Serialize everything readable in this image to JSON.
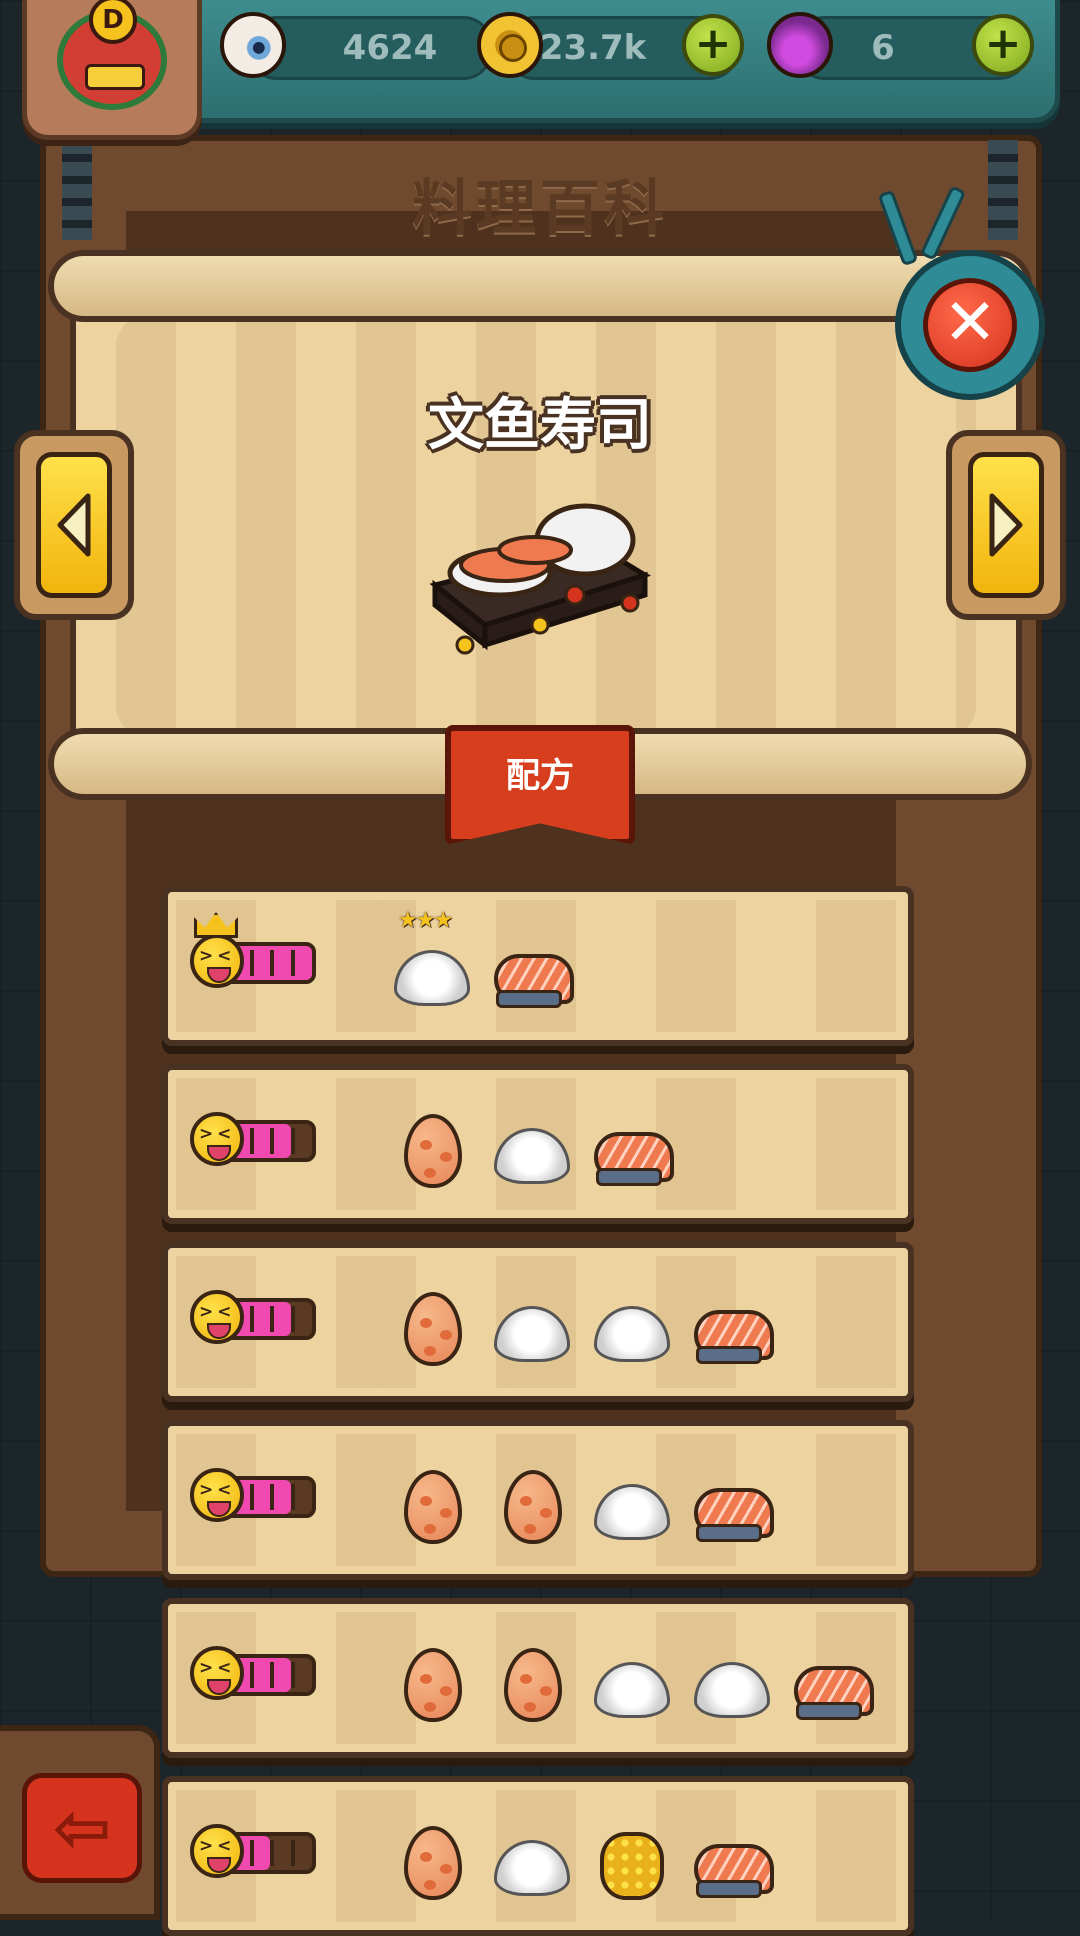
{
  "hud": {
    "rank_letter": "D",
    "eyes": "4624",
    "coins": "23.7k",
    "potions": "6",
    "plus_symbol": "+"
  },
  "board": {
    "title": "料理百科"
  },
  "dish": {
    "name": "文鱼寿司",
    "image_icon": "salmon-sushi-dish"
  },
  "recipe_label": "配方",
  "close_symbol": "✕",
  "back_symbol": "⇦",
  "recipes": [
    {
      "happiness_segments": 5,
      "crown": true,
      "stars": 3,
      "ingredients": [
        "rice",
        "salmon"
      ]
    },
    {
      "happiness_segments": 4,
      "crown": false,
      "stars": 0,
      "ingredients": [
        "egg",
        "rice",
        "salmon"
      ]
    },
    {
      "happiness_segments": 4,
      "crown": false,
      "stars": 0,
      "ingredients": [
        "egg",
        "rice",
        "rice",
        "salmon"
      ]
    },
    {
      "happiness_segments": 4,
      "crown": false,
      "stars": 0,
      "ingredients": [
        "egg",
        "egg",
        "rice",
        "salmon"
      ]
    },
    {
      "happiness_segments": 4,
      "crown": false,
      "stars": 0,
      "ingredients": [
        "egg",
        "egg",
        "rice",
        "rice",
        "salmon"
      ]
    },
    {
      "happiness_segments": 3,
      "crown": false,
      "stars": 0,
      "ingredients": [
        "egg",
        "rice",
        "corn",
        "salmon"
      ]
    }
  ],
  "colors": {
    "accent_teal": "#3e8d8e",
    "parchment": "#ecd3a0",
    "happiness_pink": "#f04ab0",
    "button_yellow": "#ffe14a",
    "close_red": "#d6331f"
  }
}
